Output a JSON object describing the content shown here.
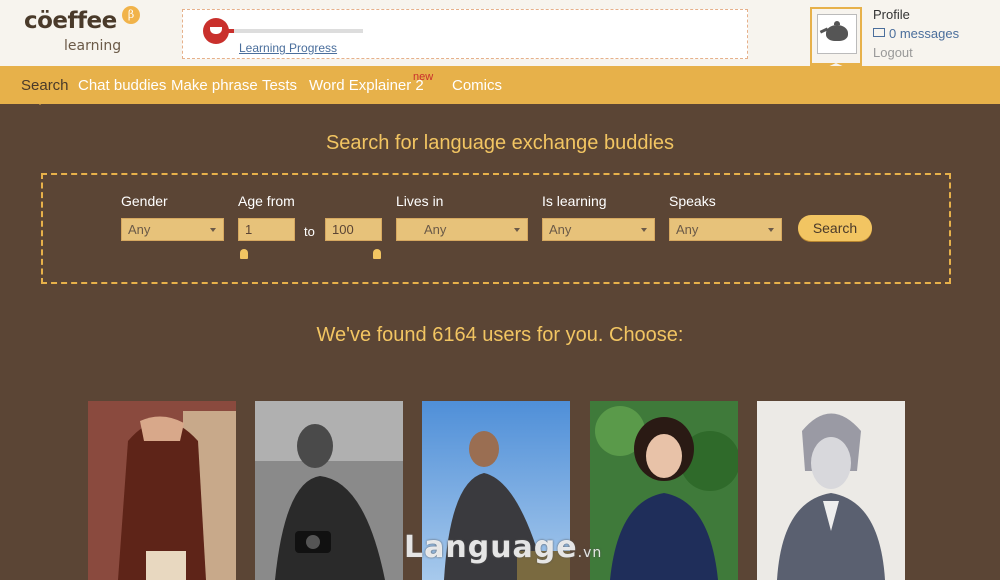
{
  "header": {
    "logo": {
      "title": "cöeffee",
      "subtitle": "learning",
      "beta": "β"
    },
    "progress": {
      "label": "Learning Progress",
      "value": 0.05
    },
    "profile": {
      "title": "Profile",
      "messages": "0 messages",
      "logout": "Logout"
    }
  },
  "nav": {
    "items": [
      {
        "label": "Search",
        "active": true
      },
      {
        "label": "Chat buddies"
      },
      {
        "label": "Make phrase"
      },
      {
        "label": "Tests"
      },
      {
        "label": "Word Explainer 2",
        "badge": "new"
      },
      {
        "label": "Comics"
      }
    ]
  },
  "search": {
    "title": "Search for language exchange buddies",
    "gender": {
      "label": "Gender",
      "value": "Any"
    },
    "age": {
      "label": "Age from",
      "from": "1",
      "to_label": "to",
      "to": "100"
    },
    "lives_in": {
      "label": "Lives in",
      "value": "Any"
    },
    "learning": {
      "label": "Is learning",
      "value": "Any"
    },
    "speaks": {
      "label": "Speaks",
      "value": "Any"
    },
    "button": "Search"
  },
  "results": {
    "title": "We've found 6164 users for you. Choose:"
  },
  "watermark": {
    "text": "Language",
    "suffix": ".vn"
  },
  "colors": {
    "accent": "#e7b14a",
    "brown": "#5b4535",
    "heading": "#f2c562",
    "header_bg": "#f7f4ee"
  }
}
